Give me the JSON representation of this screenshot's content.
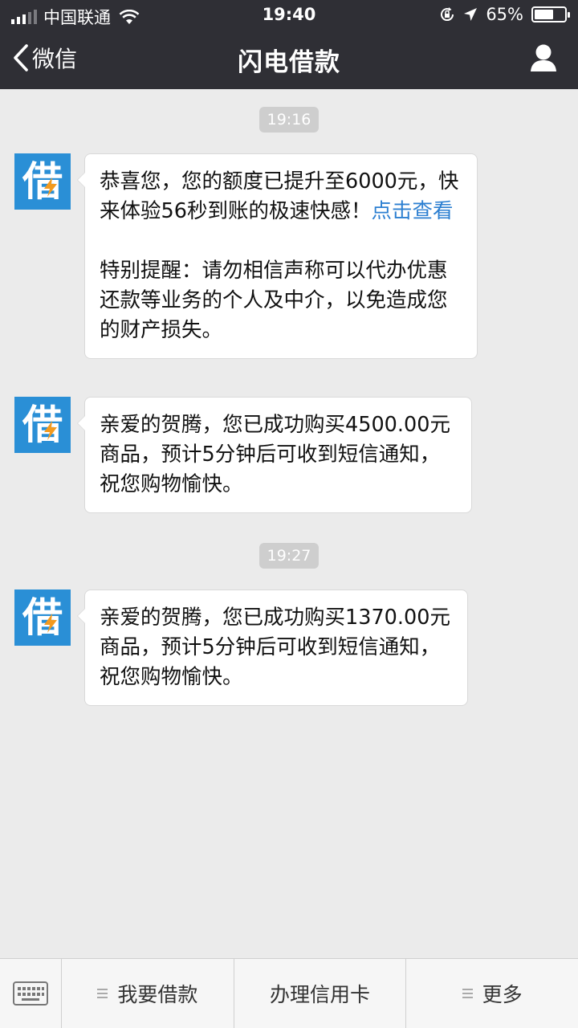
{
  "status_bar": {
    "carrier": "中国联通",
    "time": "19:40",
    "battery": "65%",
    "battery_level": 0.65
  },
  "nav": {
    "back_label": "微信",
    "title": "闪电借款"
  },
  "avatar_glyph": "借",
  "timestamps": [
    "19:16",
    "19:27"
  ],
  "messages": [
    {
      "text_before": "恭喜您，您的额度已提升至6000元，快来体验56秒到账的极速快感！",
      "link": "点击查看",
      "text_after": "特别提醒：请勿相信声称可以代办优惠还款等业务的个人及中介，以免造成您的财产损失。"
    },
    {
      "text": "亲爱的贺腾，您已成功购买4500.00元商品，预计5分钟后可收到短信通知，祝您购物愉快。"
    },
    {
      "text": "亲爱的贺腾，您已成功购买1370.00元商品，预计5分钟后可收到短信通知，祝您购物愉快。"
    }
  ],
  "menu": [
    {
      "label": "我要借款",
      "has_submenu": true
    },
    {
      "label": "办理信用卡",
      "has_submenu": false
    },
    {
      "label": "更多",
      "has_submenu": true
    }
  ],
  "colors": {
    "header": "#2f2f35",
    "chat_bg": "#ebebeb",
    "link": "#2c7fd1",
    "avatar": "#2a8fd6",
    "bolt": "#f39a1e"
  }
}
